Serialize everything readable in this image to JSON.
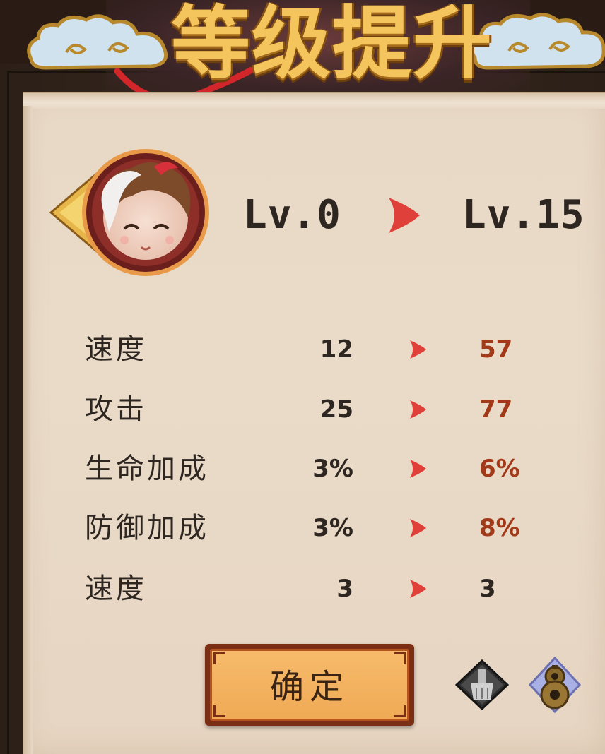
{
  "banner": {
    "title": "等级提升"
  },
  "level": {
    "from": "Lv.0",
    "to": "Lv.15"
  },
  "stats": [
    {
      "label": "速度",
      "from": "12",
      "to": "57",
      "changed": true
    },
    {
      "label": "攻击",
      "from": "25",
      "to": "77",
      "changed": true
    },
    {
      "label": "生命加成",
      "from": "3%",
      "to": "6%",
      "changed": true
    },
    {
      "label": "防御加成",
      "from": "3%",
      "to": "8%",
      "changed": true
    },
    {
      "label": "速度",
      "from": "3",
      "to": "3",
      "changed": false
    }
  ],
  "buttons": {
    "confirm": "确定"
  },
  "icons": {
    "avatar": "character-portrait-icon",
    "level_arrow": "red-arrow-icon",
    "brush": "brush-icon",
    "gourd": "gourd-icon"
  },
  "colors": {
    "paper": "#e8d8c6",
    "increased_value": "#a23a1a",
    "arrow": "#e0403a",
    "button_fill": "#f0aa55",
    "title_gold": "#f3c55c"
  }
}
